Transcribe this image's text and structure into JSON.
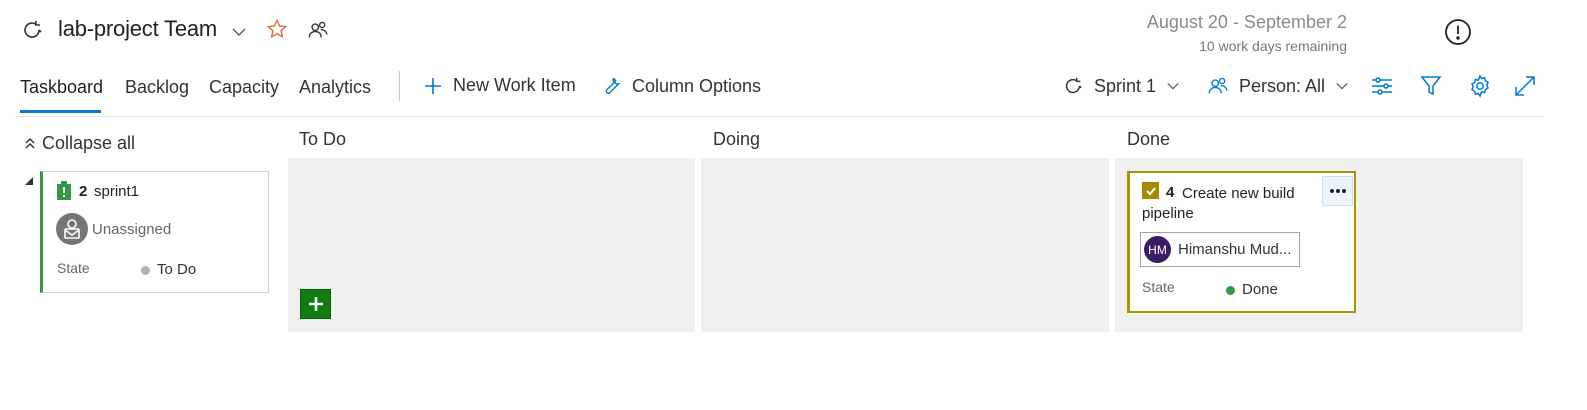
{
  "header": {
    "team_name": "lab-project Team",
    "date_range": "August 20 - September 2",
    "work_days_remaining": "10 work days remaining"
  },
  "tabs": [
    {
      "label": "Taskboard",
      "active": true
    },
    {
      "label": "Backlog",
      "active": false
    },
    {
      "label": "Capacity",
      "active": false
    },
    {
      "label": "Analytics",
      "active": false
    }
  ],
  "commands": {
    "new_work_item": "New Work Item",
    "column_options": "Column Options"
  },
  "filters": {
    "sprint": "Sprint 1",
    "person": "Person: All"
  },
  "board": {
    "collapse_label": "Collapse all",
    "columns": [
      "To Do",
      "Doing",
      "Done"
    ],
    "parent_item": {
      "id": "2",
      "title": "sprint1",
      "assignee": "Unassigned",
      "state_label": "State",
      "state": "To Do",
      "icon": "backlog-item-icon"
    },
    "task_item": {
      "id": "4",
      "title": "Create new build pipeline",
      "assignee_initials": "HM",
      "assignee_name": "Himanshu Mud...",
      "state_label": "State",
      "state": "Done",
      "icon": "task-check-icon"
    }
  },
  "colors": {
    "accent": "#0078d4",
    "parent_card_border": "#339947",
    "task_card_border": "#a89500",
    "add_button": "#107c10",
    "done_dot": "#339947",
    "todo_dot": "#b2b2b2",
    "star": "#e36b3a",
    "avatar_hm": "#3b1a66"
  }
}
